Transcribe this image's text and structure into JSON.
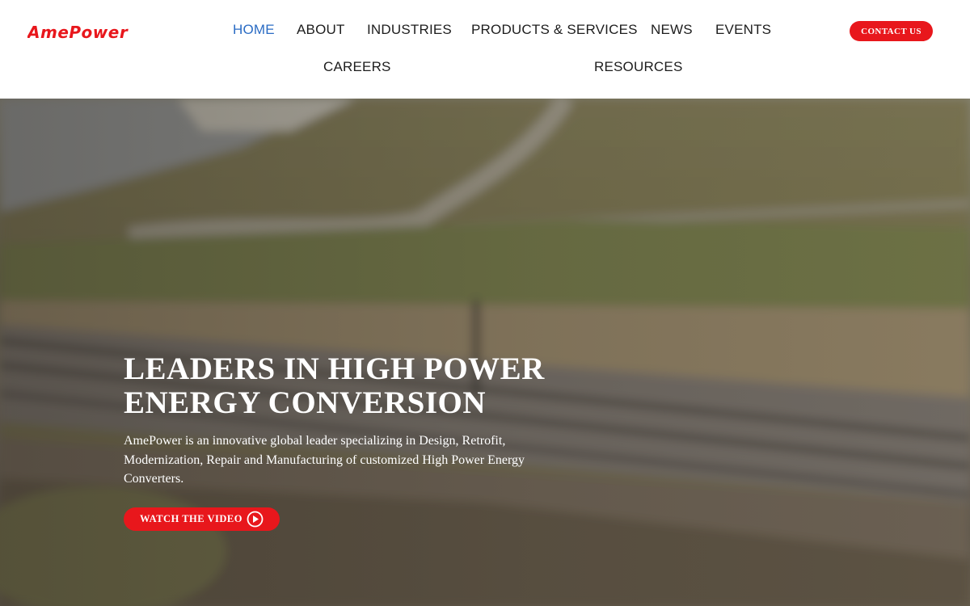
{
  "brand": {
    "name": "AmePower",
    "accent": "#e8171c",
    "active_nav_color": "#2b6cc4"
  },
  "nav": {
    "items": [
      {
        "label": "HOME",
        "active": true
      },
      {
        "label": "ABOUT"
      },
      {
        "label": "INDUSTRIES"
      },
      {
        "label": "PRODUCTS & SERVICES"
      },
      {
        "label": "NEWS"
      },
      {
        "label": "EVENTS"
      },
      {
        "label": "CAREERS"
      },
      {
        "label": "RESOURCES"
      }
    ],
    "contact_label": "CONTACT US"
  },
  "hero": {
    "title_line1": "LEADERS IN HIGH POWER",
    "title_line2": "ENERGY CONVERSION",
    "description": "AmePower is an innovative global leader specializing in Design, Retrofit, Modernization, Repair and Manufacturing of customized High Power Energy Converters.",
    "cta_label": "WATCH THE VIDEO",
    "cta_icon": "play-circle-icon"
  }
}
